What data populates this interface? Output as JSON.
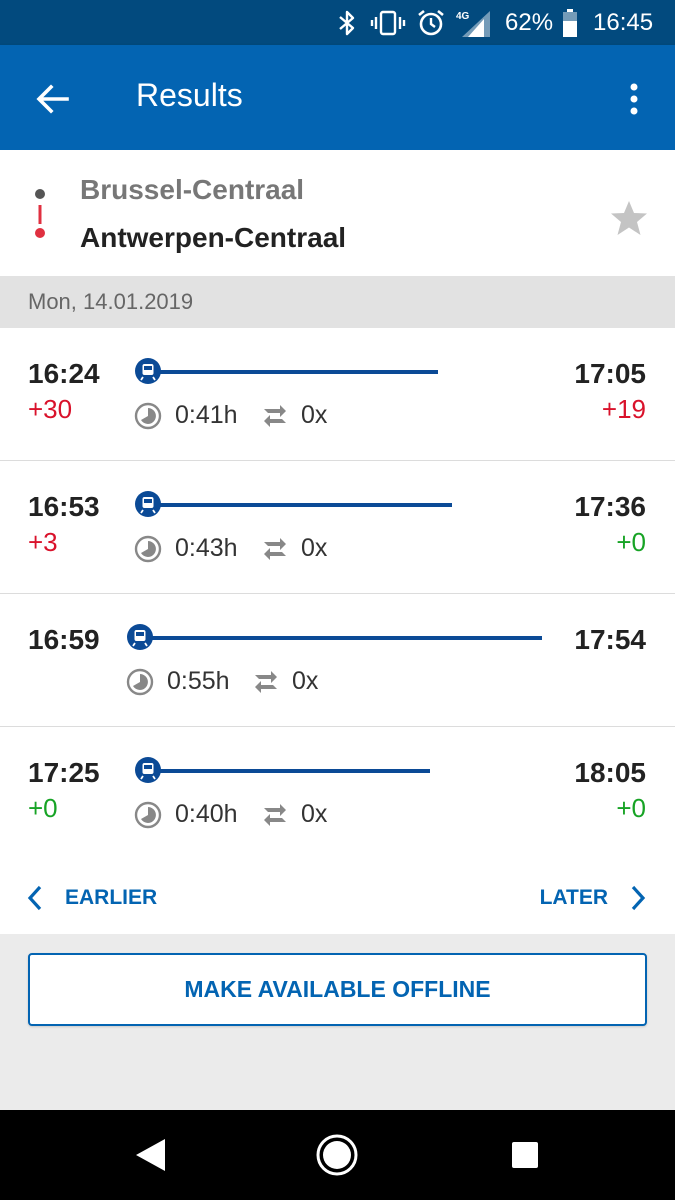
{
  "status_bar": {
    "battery_percent": "62%",
    "time": "16:45",
    "network": "4G"
  },
  "app_bar": {
    "title": "Results"
  },
  "route": {
    "from": "Brussel-Centraal",
    "to": "Antwerpen-Centraal"
  },
  "date_label": "Mon, 14.01.2019",
  "connections": [
    {
      "departure": "16:24",
      "departure_delay": "+30",
      "departure_delay_status": "late",
      "arrival": "17:05",
      "arrival_delay": "+19",
      "arrival_delay_status": "late",
      "duration": "0:41h",
      "changes": "0x"
    },
    {
      "departure": "16:53",
      "departure_delay": "+3",
      "departure_delay_status": "late",
      "arrival": "17:36",
      "arrival_delay": "+0",
      "arrival_delay_status": "on-time",
      "duration": "0:43h",
      "changes": "0x"
    },
    {
      "departure": "16:59",
      "departure_delay": "",
      "departure_delay_status": "none",
      "arrival": "17:54",
      "arrival_delay": "",
      "arrival_delay_status": "none",
      "duration": "0:55h",
      "changes": "0x"
    },
    {
      "departure": "17:25",
      "departure_delay": "+0",
      "departure_delay_status": "on-time",
      "arrival": "18:05",
      "arrival_delay": "+0",
      "arrival_delay_status": "on-time",
      "duration": "0:40h",
      "changes": "0x"
    }
  ],
  "pager": {
    "earlier_label": "EARLIER",
    "later_label": "LATER"
  },
  "offline_button_label": "MAKE AVAILABLE OFFLINE",
  "colors": {
    "primary": "#0364b2",
    "status_bar": "#024a7e",
    "late": "#d9122b",
    "on_time": "#17a325",
    "track": "#0b4a96"
  },
  "icons": {
    "back": "arrow-left-icon",
    "more": "more-vertical-icon",
    "favorite": "star-icon",
    "train": "train-icon",
    "duration": "clock-icon",
    "changes": "transfer-icon",
    "earlier": "chevron-left-icon",
    "later": "chevron-right-icon"
  }
}
